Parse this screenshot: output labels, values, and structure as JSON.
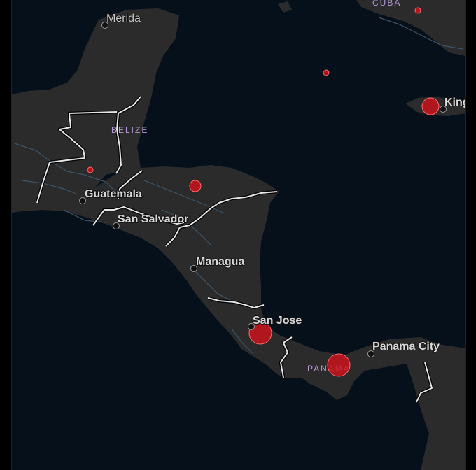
{
  "map": {
    "countries": [
      {
        "id": "cuba",
        "label": "CUBA"
      },
      {
        "id": "belize",
        "label": "BELIZE"
      },
      {
        "id": "panama",
        "label": "PANAMA"
      }
    ],
    "cities": [
      {
        "id": "merida",
        "label": "Merida"
      },
      {
        "id": "guatemala",
        "label": "Guatemala"
      },
      {
        "id": "san-salvador",
        "label": "San Salvador"
      },
      {
        "id": "managua",
        "label": "Managua"
      },
      {
        "id": "san-jose",
        "label": "San Jose"
      },
      {
        "id": "panama-city",
        "label": "Panama City"
      },
      {
        "id": "kingston",
        "label": "King"
      }
    ],
    "colors": {
      "ocean": "#06101b",
      "land": "#2b2b2c",
      "border": "#e6e6e6",
      "bubble": "#d0121b",
      "country_label": "#b79ad6"
    }
  }
}
